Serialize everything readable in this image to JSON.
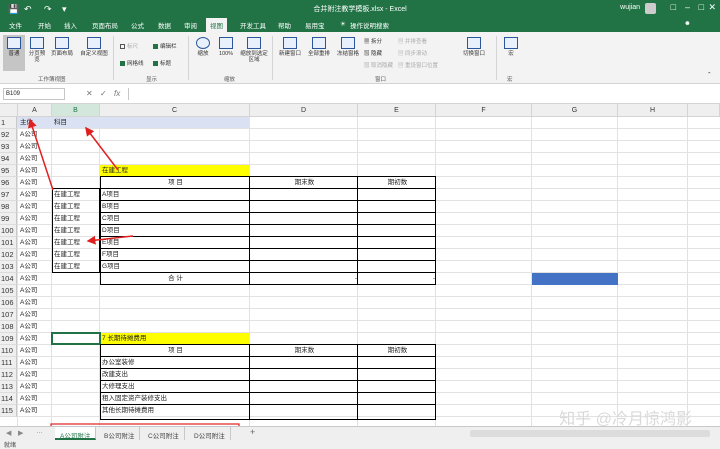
{
  "window": {
    "title": "合并附注教学模板.xlsx - Excel",
    "user": "wujian"
  },
  "quick_access": [
    "save-icon",
    "undo-icon",
    "redo-icon"
  ],
  "ribbon_tabs": [
    "文件",
    "开始",
    "插入",
    "页面布局",
    "公式",
    "数据",
    "审阅",
    "视图",
    "开发工具",
    "帮助",
    "易用宝",
    "操作说明搜索"
  ],
  "ribbon_active": "视图",
  "ribbon": {
    "normal": "普通",
    "page_break": "分页预览",
    "page_layout": "页面布局",
    "custom_view": "自定义视图",
    "group_views": "工作簿视图",
    "ruler": "标尺",
    "formula_bar": "编辑栏",
    "gridlines": "网格线",
    "headings": "标题",
    "group_show": "显示",
    "zoom": "缩放",
    "zoom100": "100%",
    "zoom_sel": "缩放到选定区域",
    "group_zoom": "缩放",
    "new_window": "新建窗口",
    "arrange": "全部重排",
    "freeze": "冻结窗格",
    "split": "拆分",
    "hide": "隐藏",
    "unhide": "取消隐藏",
    "side_by_side": "并排查看",
    "sync_scroll": "同步滚动",
    "reset_pos": "重设窗口位置",
    "switch_window": "切换窗口",
    "group_window": "窗口",
    "macro": "宏",
    "group_macro": "宏"
  },
  "formula_bar": {
    "name_box": "B109",
    "fx": "fx"
  },
  "columns": [
    "A",
    "B",
    "C",
    "D",
    "E",
    "F",
    "G",
    "H"
  ],
  "selected_column": "B",
  "rows": [
    {
      "n": "1",
      "a": "主体",
      "b": "科目",
      "c": "",
      "d": "",
      "e": ""
    },
    {
      "n": "92",
      "a": "A公司",
      "b": "",
      "c": "",
      "d": "",
      "e": ""
    },
    {
      "n": "93",
      "a": "A公司",
      "b": "",
      "c": "",
      "d": "",
      "e": ""
    },
    {
      "n": "94",
      "a": "A公司",
      "b": "",
      "c": "",
      "d": "",
      "e": ""
    },
    {
      "n": "95",
      "a": "A公司",
      "b": "",
      "c": "在建工程",
      "d": "",
      "e": ""
    },
    {
      "n": "96",
      "a": "A公司",
      "b": "",
      "c": "项  目",
      "d": "期末数",
      "e": "期初数"
    },
    {
      "n": "97",
      "a": "A公司",
      "b": "在建工程",
      "c": "A项目",
      "d": "",
      "e": ""
    },
    {
      "n": "98",
      "a": "A公司",
      "b": "在建工程",
      "c": "B项目",
      "d": "",
      "e": ""
    },
    {
      "n": "99",
      "a": "A公司",
      "b": "在建工程",
      "c": "C项目",
      "d": "",
      "e": ""
    },
    {
      "n": "100",
      "a": "A公司",
      "b": "在建工程",
      "c": "D项目",
      "d": "",
      "e": ""
    },
    {
      "n": "101",
      "a": "A公司",
      "b": "在建工程",
      "c": "E项目",
      "d": "",
      "e": ""
    },
    {
      "n": "102",
      "a": "A公司",
      "b": "在建工程",
      "c": "F项目",
      "d": "",
      "e": ""
    },
    {
      "n": "103",
      "a": "A公司",
      "b": "在建工程",
      "c": "G项目",
      "d": "",
      "e": ""
    },
    {
      "n": "104",
      "a": "A公司",
      "b": "",
      "c": "合  计",
      "d": "-",
      "e": "-"
    },
    {
      "n": "105",
      "a": "A公司",
      "b": "",
      "c": "",
      "d": "",
      "e": ""
    },
    {
      "n": "106",
      "a": "A公司",
      "b": "",
      "c": "",
      "d": "",
      "e": ""
    },
    {
      "n": "107",
      "a": "A公司",
      "b": "",
      "c": "",
      "d": "",
      "e": ""
    },
    {
      "n": "108",
      "a": "A公司",
      "b": "",
      "c": "",
      "d": "",
      "e": ""
    },
    {
      "n": "109",
      "a": "A公司",
      "b": "",
      "c": "7 长期待摊费用",
      "d": "",
      "e": ""
    },
    {
      "n": "110",
      "a": "A公司",
      "b": "",
      "c": "项  目",
      "d": "期末数",
      "e": "期初数"
    },
    {
      "n": "111",
      "a": "A公司",
      "b": "",
      "c": "办公室装修",
      "d": "",
      "e": ""
    },
    {
      "n": "112",
      "a": "A公司",
      "b": "",
      "c": "改建支出",
      "d": "",
      "e": ""
    },
    {
      "n": "113",
      "a": "A公司",
      "b": "",
      "c": "大修理支出",
      "d": "",
      "e": ""
    },
    {
      "n": "114",
      "a": "A公司",
      "b": "",
      "c": "租入固定资产装修支出",
      "d": "",
      "e": ""
    },
    {
      "n": "115",
      "a": "A公司",
      "b": "",
      "c": "其他长期待摊费用",
      "d": "",
      "e": ""
    }
  ],
  "sheets": [
    "A公司附注",
    "B公司附注",
    "C公司附注",
    "D公司附注"
  ],
  "active_sheet": "A公司附注",
  "add_sheet": "+",
  "status": "就绪",
  "watermark": "知乎 @冷月惊鸿影",
  "colors": {
    "accent": "#217346",
    "highlight": "#ffff00",
    "fill_blue": "#4472c4",
    "arrow": "#e02020"
  }
}
